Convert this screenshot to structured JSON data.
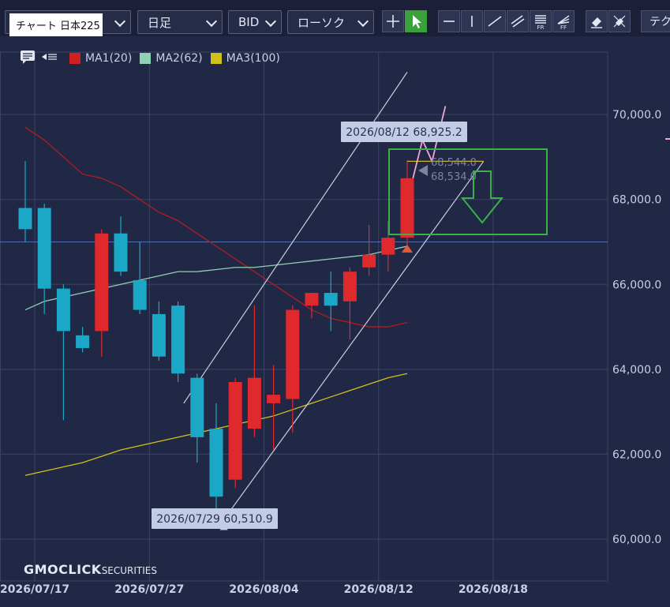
{
  "toolbar": {
    "title": "チャート 日本225",
    "period": "日足",
    "price_type": "BID",
    "chart_style": "ローソク",
    "tech_label": "テク",
    "tools": [
      {
        "name": "crosshair-tool-button",
        "icon": "crosshair-icon",
        "active": false
      },
      {
        "name": "pointer-tool-button",
        "icon": "cursor-arrow-icon",
        "active": true
      },
      {
        "name": "horizontal-line-tool-button",
        "icon": "horizontal-line-icon",
        "active": false
      },
      {
        "name": "vertical-line-tool-button",
        "icon": "vertical-line-icon",
        "active": false
      },
      {
        "name": "trend-line-tool-button",
        "icon": "trend-line-icon",
        "active": false
      },
      {
        "name": "parallel-channel-tool-button",
        "icon": "parallel-lines-icon",
        "active": false
      },
      {
        "name": "fibonacci-retracement-tool-button",
        "icon": "fibonacci-retracement-icon",
        "label": "FR",
        "active": false
      },
      {
        "name": "fibonacci-fan-tool-button",
        "icon": "fibonacci-fan-icon",
        "label": "FF",
        "active": false
      },
      {
        "name": "eraser-tool-button",
        "icon": "eraser-icon",
        "active": false
      },
      {
        "name": "erase-all-tool-button",
        "icon": "erase-all-icon",
        "active": false
      }
    ]
  },
  "legend": {
    "items": [
      {
        "label": "MA1(20)",
        "color": "#d11f1f"
      },
      {
        "label": "MA2(62)",
        "color": "#8fd1b3"
      },
      {
        "label": "MA3(100)",
        "color": "#cfc11a"
      }
    ]
  },
  "branding": {
    "logo": "GMOCLICK",
    "logo_suffix": "SECURITIES"
  },
  "colors": {
    "up": "#e0292c",
    "down": "#1ba7c6",
    "grid": "#3b4364",
    "background": "#202846"
  },
  "chart_data": {
    "type": "candlestick",
    "ylim": [
      59200,
      71100
    ],
    "y_ticks": [
      60000,
      62000,
      64000,
      66000,
      68000,
      70000
    ],
    "y_tick_labels": [
      "60,000.0",
      "62,000.0",
      "64,000.0",
      "66,000.0",
      "68,000.0",
      "70,000.0"
    ],
    "x_ticks": [
      "2026/07/17",
      "2026/07/27",
      "2026/08/04",
      "2026/08/12",
      "2026/08/18"
    ],
    "x_tick_index": [
      0.5,
      6.5,
      12.5,
      18.5,
      24.5
    ],
    "candles": [
      {
        "o": 67800,
        "h": 68900,
        "l": 67000,
        "c": 67300
      },
      {
        "o": 67800,
        "h": 67900,
        "l": 65300,
        "c": 65900
      },
      {
        "o": 65900,
        "h": 66000,
        "l": 62800,
        "c": 64900
      },
      {
        "o": 64800,
        "h": 65000,
        "l": 64400,
        "c": 64500
      },
      {
        "o": 64900,
        "h": 67300,
        "l": 64300,
        "c": 67200
      },
      {
        "o": 67200,
        "h": 67600,
        "l": 66200,
        "c": 66300
      },
      {
        "o": 66100,
        "h": 67000,
        "l": 65300,
        "c": 65400
      },
      {
        "o": 65300,
        "h": 65600,
        "l": 64200,
        "c": 64300
      },
      {
        "o": 65500,
        "h": 65600,
        "l": 63700,
        "c": 63900
      },
      {
        "o": 63800,
        "h": 63900,
        "l": 61800,
        "c": 62400
      },
      {
        "o": 62600,
        "h": 63200,
        "l": 60500,
        "c": 61000
      },
      {
        "o": 61400,
        "h": 63800,
        "l": 61200,
        "c": 63700
      },
      {
        "o": 62600,
        "h": 65500,
        "l": 62400,
        "c": 63800
      },
      {
        "o": 63200,
        "h": 64100,
        "l": 62100,
        "c": 63400
      },
      {
        "o": 63300,
        "h": 65500,
        "l": 62500,
        "c": 65400
      },
      {
        "o": 65500,
        "h": 65800,
        "l": 65200,
        "c": 65800
      },
      {
        "o": 65800,
        "h": 66300,
        "l": 64900,
        "c": 65500
      },
      {
        "o": 65600,
        "h": 66400,
        "l": 64700,
        "c": 66300
      },
      {
        "o": 66400,
        "h": 67400,
        "l": 66200,
        "c": 66700
      },
      {
        "o": 66700,
        "h": 67500,
        "l": 66300,
        "c": 67100
      },
      {
        "o": 67100,
        "h": 68925.2,
        "l": 66900,
        "c": 68500
      }
    ],
    "series": [
      {
        "name": "MA1(20)",
        "color": "#b31c1c",
        "values": [
          69700,
          69400,
          69000,
          68600,
          68500,
          68300,
          68000,
          67700,
          67500,
          67200,
          66900,
          66600,
          66300,
          66000,
          65700,
          65400,
          65200,
          65100,
          65000,
          65000,
          65100
        ]
      },
      {
        "name": "MA2(62)",
        "color": "#8fd1b3",
        "values": [
          65400,
          65600,
          65700,
          65800,
          65900,
          66000,
          66100,
          66200,
          66300,
          66300,
          66350,
          66400,
          66400,
          66450,
          66500,
          66550,
          66600,
          66650,
          66700,
          66800,
          66900
        ]
      },
      {
        "name": "MA3(100)",
        "color": "#cfc11a",
        "values": [
          61500,
          61600,
          61700,
          61800,
          61950,
          62100,
          62200,
          62300,
          62400,
          62500,
          62600,
          62700,
          62800,
          62900,
          63050,
          63200,
          63350,
          63500,
          63650,
          63800,
          63900
        ]
      }
    ],
    "current_price": 67000,
    "annotations": [
      {
        "label": "2026/08/12 68,925.2",
        "index": 20,
        "value": 68925.2
      },
      {
        "label": "2026/07/29 60,510.9",
        "index": 10,
        "value": 60510.9
      },
      {
        "label": "68,544.0",
        "index": 20,
        "value": 68544.0
      },
      {
        "label": "68,534.0",
        "index": 20,
        "value": 68534.0
      }
    ]
  }
}
